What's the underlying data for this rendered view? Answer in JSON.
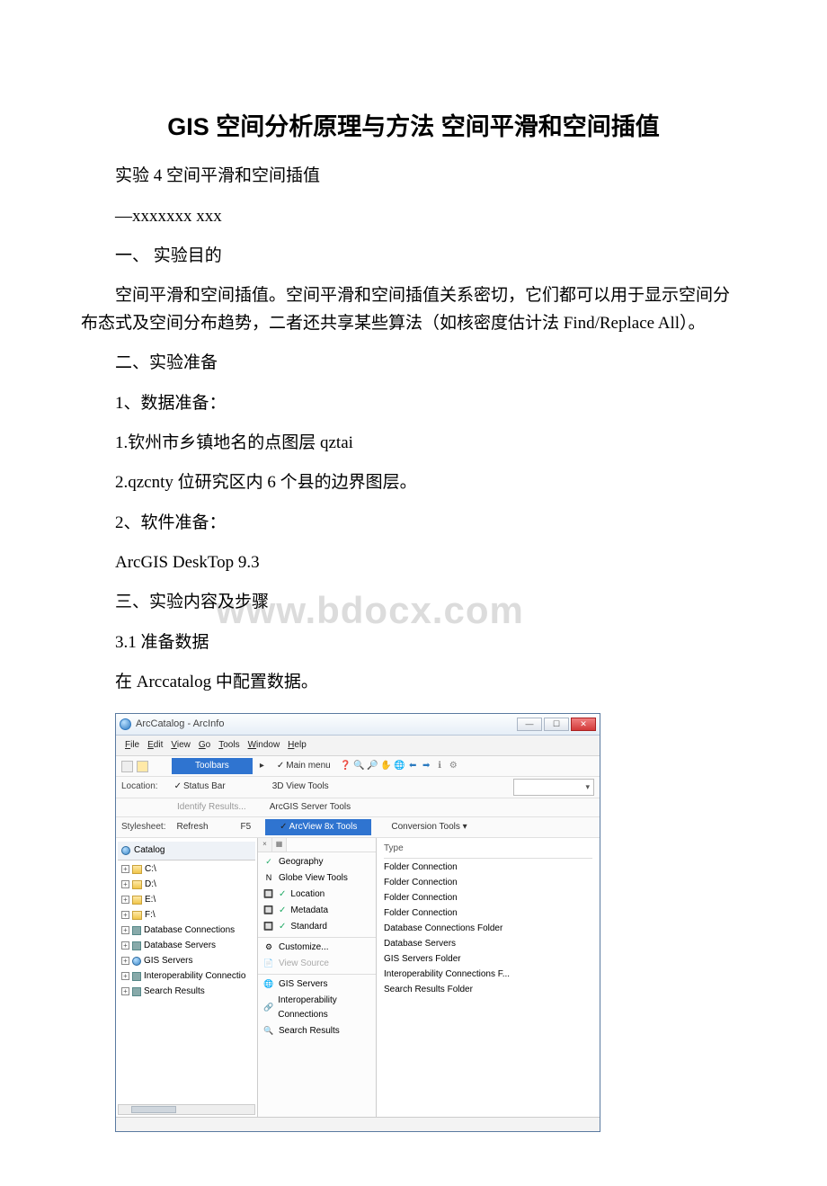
{
  "title": "GIS 空间分析原理与方法 空间平滑和空间插值",
  "p1": "实验 4 空间平滑和空间插值",
  "p2": "—xxxxxxx xxx",
  "p3": "一、 实验目的",
  "p4": "空间平滑和空间插值。空间平滑和空间插值关系密切，它们都可以用于显示空间分布态式及空间分布趋势，二者还共享某些算法（如核密度估计法 Find/Replace All）。",
  "p5": "二、实验准备",
  "p6": "1、数据准备：",
  "p7": "1.钦州市乡镇地名的点图层 qztai",
  "p8": "2.qzcnty 位研究区内 6 个县的边界图层。",
  "p9": "2、软件准备：",
  "p10": " ArcGIS DeskTop 9.3",
  "p11": "三、实验内容及步骤",
  "p12": "3.1 准备数据",
  "p13": "在 Arccatalog 中配置数据。",
  "watermark": "www.bdocx.com",
  "arc": {
    "title": "ArcCatalog - ArcInfo",
    "menu": {
      "file": "File",
      "edit": "Edit",
      "view": "View",
      "go": "Go",
      "tools": "Tools",
      "window": "Window",
      "help": "Help"
    },
    "row1": {
      "location": "Location:",
      "toolbars": "Toolbars",
      "statusbar": "Status Bar",
      "identify": "Identify Results..."
    },
    "row2": {
      "stylesheet": "Stylesheet:",
      "refresh": "Refresh",
      "f5": "F5"
    },
    "midmenu": {
      "mainmenu": "Main menu",
      "threed": "3D View Tools",
      "server": "ArcGIS Server Tools",
      "arcview": "ArcView 8x Tools",
      "geography": "Geography",
      "globe": "Globe View Tools",
      "locationm": "Location",
      "metadata": "Metadata",
      "standard": "Standard",
      "customize": "Customize...",
      "viewsource": "View Source",
      "gisservers": "GIS Servers",
      "interop": "Interoperability Connections",
      "search": "Search Results",
      "n": "N"
    },
    "tree": {
      "catalog": "Catalog",
      "c": "C:\\",
      "d": "D:\\",
      "e": "E:\\",
      "f": "F:\\",
      "dbconn": "Database Connections",
      "dbserv": "Database Servers",
      "gis": "GIS Servers",
      "interop": "Interoperability Connectio",
      "search": "Search Results"
    },
    "right": {
      "convtools": "Conversion Tools ▾",
      "typehdr": "Type",
      "rows": [
        "Folder Connection",
        "Folder Connection",
        "Folder Connection",
        "Folder Connection",
        "Database Connections Folder",
        "Database Servers",
        "GIS Servers Folder",
        "Interoperability Connections F...",
        "Search Results Folder"
      ]
    }
  }
}
